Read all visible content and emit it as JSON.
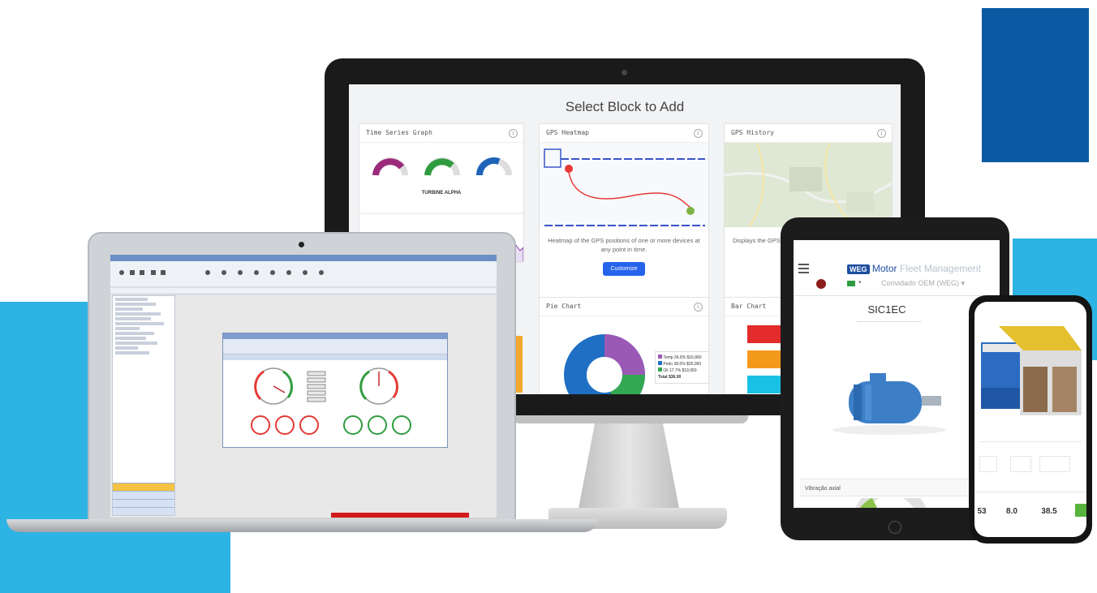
{
  "monitor": {
    "title": "Select Block to Add",
    "cards": {
      "ts": {
        "title": "Time Series Graph",
        "chart_label": "TURBINE ALPHA"
      },
      "gpsh": {
        "title": "GPS Heatmap",
        "desc": "Heatmap of the GPS positions of one or more devices at any point in time.",
        "button": "Customize"
      },
      "gpshist": {
        "title": "GPS History",
        "desc": "Displays the GPS"
      },
      "pie": {
        "title": "Pie Chart",
        "legend": [
          {
            "label": "Temp 36.6%",
            "value": "$16,860",
            "color": "#9b59b6"
          },
          {
            "label": "Pedo 38.6%",
            "value": "$35,060",
            "color": "#1f6fc5"
          },
          {
            "label": "Oil 17.7%",
            "value": "$19,950",
            "color": "#33a853"
          }
        ],
        "total_label": "Total",
        "total_value": "$36.00"
      },
      "bar": {
        "title": "Bar Chart",
        "bar_colors": [
          "#e32b2b",
          "#f39a1d",
          "#19c2e4"
        ]
      }
    }
  },
  "tablet": {
    "brand_logo": "WEG",
    "brand_motor": "Motor",
    "brand_rest": "Fleet Management",
    "user": "Convidado OEM (WEG)",
    "device_name": "SIC1EC",
    "section": "Vibração axial"
  },
  "phone": {
    "values": [
      "53",
      "8.0",
      "38.5"
    ]
  },
  "colors": {
    "accent_blue": "#0a5aa3",
    "accent_cyan": "#2db3e4",
    "button_blue": "#2563eb"
  }
}
